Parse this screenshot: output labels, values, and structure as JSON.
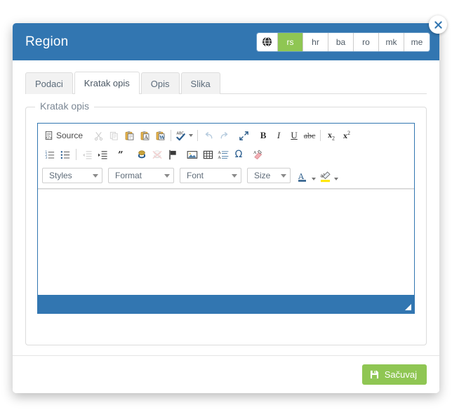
{
  "modal": {
    "title": "Region",
    "close_icon": "close-icon"
  },
  "languages": {
    "globe_icon": "globe-icon",
    "items": [
      {
        "code": "rs",
        "active": true
      },
      {
        "code": "hr",
        "active": false
      },
      {
        "code": "ba",
        "active": false
      },
      {
        "code": "ro",
        "active": false
      },
      {
        "code": "mk",
        "active": false
      },
      {
        "code": "me",
        "active": false
      }
    ]
  },
  "tabs": [
    {
      "label": "Podaci",
      "active": false
    },
    {
      "label": "Kratak opis",
      "active": true
    },
    {
      "label": "Opis",
      "active": false
    },
    {
      "label": "Slika",
      "active": false
    }
  ],
  "fieldset": {
    "legend": "Kratak opis"
  },
  "editor": {
    "content_value": "",
    "toolbar": {
      "row1": [
        {
          "name": "source-button",
          "label": "Source",
          "icon": "source-icon"
        },
        {
          "name": "cut-button",
          "icon": "scissors-icon",
          "label": ""
        },
        {
          "name": "copy-button",
          "icon": "copy-icon",
          "label": ""
        },
        {
          "name": "paste-button",
          "icon": "paste-icon",
          "label": ""
        },
        {
          "name": "paste-as-plain-text-button",
          "icon": "paste-text-icon",
          "label": ""
        },
        {
          "name": "paste-from-word-button",
          "icon": "paste-word-icon",
          "label": ""
        },
        {
          "name": "spell-check-button",
          "icon": "abc-check-icon",
          "label": ""
        },
        {
          "name": "undo-button",
          "icon": "undo-arrow-icon",
          "label": ""
        },
        {
          "name": "redo-button",
          "icon": "redo-arrow-icon",
          "label": ""
        },
        {
          "name": "maximize-button",
          "icon": "maximize-icon",
          "label": ""
        },
        {
          "name": "bold-button",
          "icon": "bold-icon",
          "label": "B"
        },
        {
          "name": "italic-button",
          "icon": "italic-icon",
          "label": "I"
        },
        {
          "name": "underline-button",
          "icon": "underline-icon",
          "label": "U"
        },
        {
          "name": "strikethrough-button",
          "icon": "strikethrough-icon",
          "label": "abc"
        },
        {
          "name": "subscript-button",
          "icon": "subscript-icon",
          "label": "x2"
        },
        {
          "name": "superscript-button",
          "icon": "superscript-icon",
          "label": "x2"
        }
      ],
      "row2": [
        {
          "name": "numbered-list-button",
          "icon": "numbered-list-icon"
        },
        {
          "name": "bulleted-list-button",
          "icon": "bulleted-list-icon"
        },
        {
          "name": "outdent-button",
          "icon": "outdent-icon"
        },
        {
          "name": "indent-button",
          "icon": "indent-icon"
        },
        {
          "name": "blockquote-button",
          "icon": "quote-icon"
        },
        {
          "name": "link-button",
          "icon": "link-icon"
        },
        {
          "name": "unlink-button",
          "icon": "unlink-icon"
        },
        {
          "name": "anchor-button",
          "icon": "flag-icon"
        },
        {
          "name": "image-button",
          "icon": "image-icon"
        },
        {
          "name": "table-button",
          "icon": "table-icon"
        },
        {
          "name": "horizontal-rule-button",
          "icon": "text-lines-icon"
        },
        {
          "name": "special-character-button",
          "icon": "omega-icon"
        },
        {
          "name": "remove-format-button",
          "icon": "eraser-icon"
        }
      ],
      "row3": {
        "styles_label": "Styles",
        "format_label": "Format",
        "font_label": "Font",
        "size_label": "Size",
        "text_color_icon": "text-color-icon",
        "background_color_icon": "background-color-icon"
      }
    }
  },
  "footer": {
    "save_label": "Sačuvaj",
    "save_icon": "floppy-disk-icon"
  },
  "colors": {
    "header_blue": "#3276b1",
    "accent_green": "#8fc653",
    "panel_white": "#ffffff",
    "border_gray": "#dcdcdc"
  }
}
